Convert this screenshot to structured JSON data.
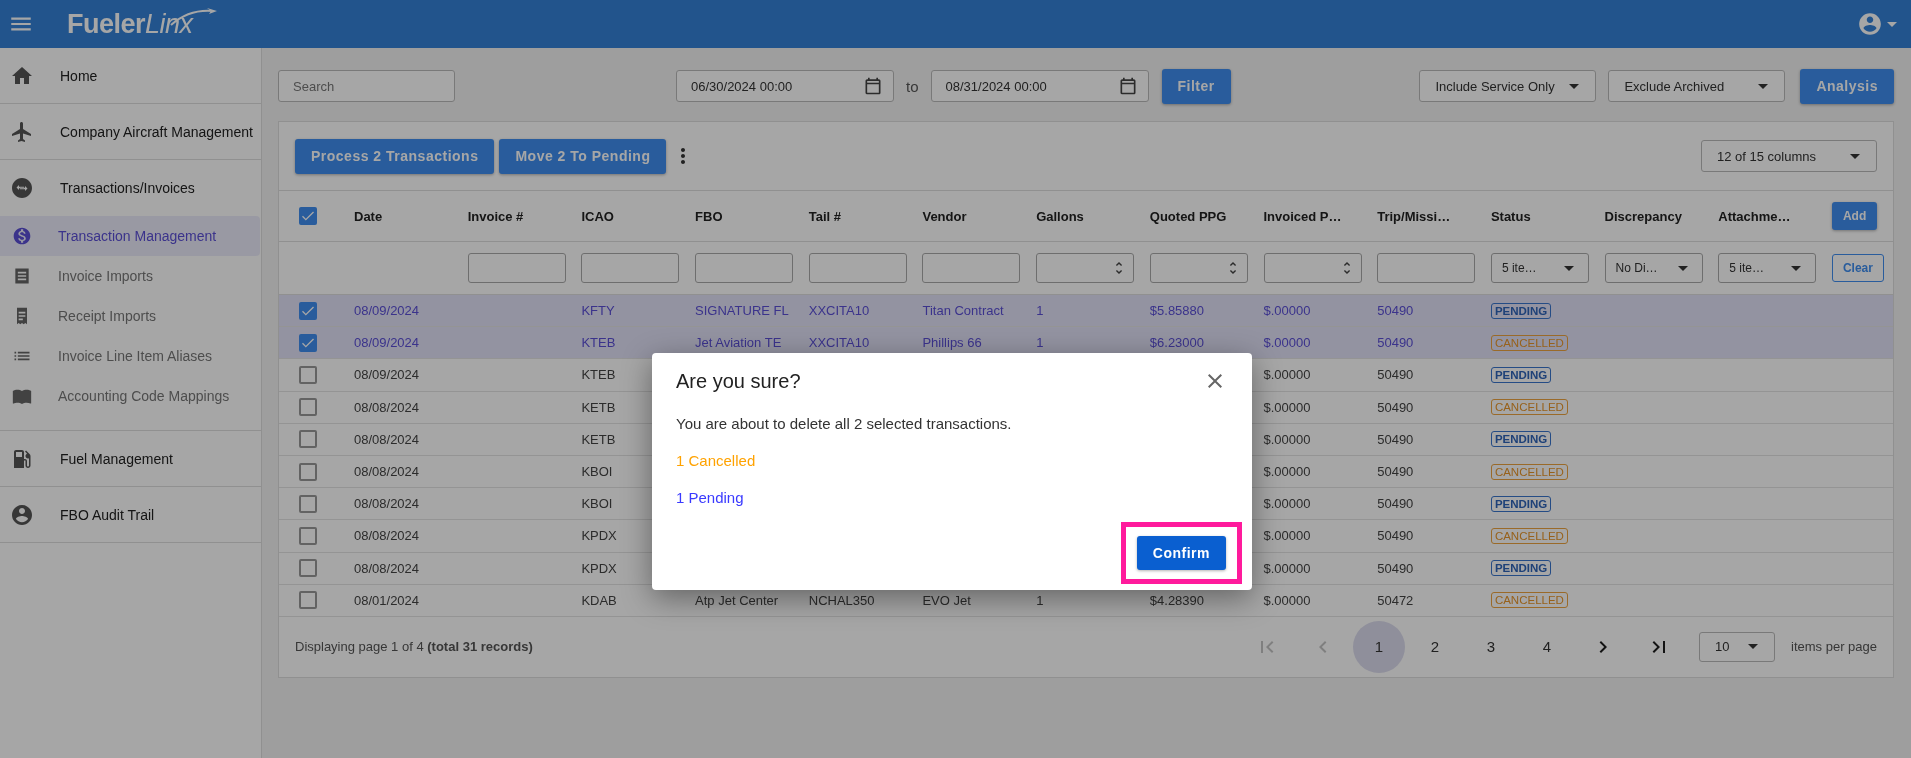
{
  "top_bar": {
    "logo": [
      "Fueler",
      "Linx"
    ]
  },
  "sidebar": {
    "items": [
      {
        "label": "Home",
        "selected": false
      },
      {
        "label": "Company Aircraft Management",
        "selected": false
      },
      {
        "label": "Transactions/Invoices",
        "selected": false,
        "expanded": true,
        "children": [
          {
            "label": "Transaction Management",
            "selected": true
          },
          {
            "label": "Invoice Imports",
            "selected": false
          },
          {
            "label": "Receipt Imports",
            "selected": false
          },
          {
            "label": "Invoice Line Item Aliases",
            "selected": false
          },
          {
            "label": "Accounting Code Mappings",
            "selected": false
          }
        ]
      },
      {
        "label": "Fuel Management",
        "selected": false
      },
      {
        "label": "FBO Audit Trail",
        "selected": false
      }
    ]
  },
  "toolbar": {
    "search": {
      "placeholder": "Search"
    },
    "date_from": "06/30/2024 00:00",
    "to_label": "to",
    "date_to": "08/31/2024 00:00",
    "filter_button": "Filter",
    "dropdowns": [
      "Include Service Only",
      "Exclude Archived"
    ],
    "analysis_button": "Analysis"
  },
  "table_toolbar": {
    "buttons": [
      "Process 2 Transactions",
      "Move 2 To Pending"
    ],
    "columns_dropdown": "12 of 15 columns"
  },
  "table": {
    "select_all_checked": true,
    "add_button": "Add",
    "clear_button": "Clear",
    "columns": [
      "Date",
      "Invoice #",
      "ICAO",
      "FBO",
      "Tail #",
      "Vendor",
      "Gallons",
      "Quoted PPG",
      "Invoiced P…",
      "Trip/Missi…",
      "Status",
      "Discrepancy",
      "Attachme…"
    ],
    "filters": [
      {
        "kind": "none"
      },
      {
        "kind": "text"
      },
      {
        "kind": "text"
      },
      {
        "kind": "text"
      },
      {
        "kind": "text"
      },
      {
        "kind": "text"
      },
      {
        "kind": "number"
      },
      {
        "kind": "number"
      },
      {
        "kind": "number"
      },
      {
        "kind": "text"
      },
      {
        "kind": "select",
        "value": "5 ite…"
      },
      {
        "kind": "select",
        "value": "No Di…"
      },
      {
        "kind": "select",
        "value": "5 ite…"
      }
    ],
    "rows": [
      {
        "selected": true,
        "date": "08/09/2024",
        "icao": "KFTY",
        "fbo": "SIGNATURE FL",
        "tail": "XXCITA10",
        "vendor": "Titan Contract",
        "gallons": "1",
        "quoted": "$5.85880",
        "invoiced": "$.00000",
        "trip": "50490",
        "status": {
          "label": "PENDING",
          "kind": "pending"
        }
      },
      {
        "selected": true,
        "date": "08/09/2024",
        "icao": "KTEB",
        "fbo": "Jet Aviation TE",
        "tail": "XXCITA10",
        "vendor": "Phillips 66",
        "gallons": "1",
        "quoted": "$6.23000",
        "invoiced": "$.00000",
        "trip": "50490",
        "status": {
          "label": "CANCELLED",
          "kind": "cancelled"
        }
      },
      {
        "selected": false,
        "date": "08/09/2024",
        "icao": "KTEB",
        "invoiced": "$.00000",
        "trip": "50490",
        "status": {
          "label": "PENDING",
          "kind": "pending"
        }
      },
      {
        "selected": false,
        "date": "08/08/2024",
        "icao": "KETB",
        "invoiced": "$.00000",
        "trip": "50490",
        "status": {
          "label": "CANCELLED",
          "kind": "cancelled"
        }
      },
      {
        "selected": false,
        "date": "08/08/2024",
        "icao": "KETB",
        "invoiced": "$.00000",
        "trip": "50490",
        "status": {
          "label": "PENDING",
          "kind": "pending"
        }
      },
      {
        "selected": false,
        "date": "08/08/2024",
        "icao": "KBOI",
        "invoiced": "$.00000",
        "trip": "50490",
        "status": {
          "label": "CANCELLED",
          "kind": "cancelled"
        }
      },
      {
        "selected": false,
        "date": "08/08/2024",
        "icao": "KBOI",
        "invoiced": "$.00000",
        "trip": "50490",
        "status": {
          "label": "PENDING",
          "kind": "pending"
        }
      },
      {
        "selected": false,
        "date": "08/08/2024",
        "icao": "KPDX",
        "invoiced": "$.00000",
        "trip": "50490",
        "status": {
          "label": "CANCELLED",
          "kind": "cancelled"
        }
      },
      {
        "selected": false,
        "date": "08/08/2024",
        "icao": "KPDX",
        "invoiced": "$.00000",
        "trip": "50490",
        "status": {
          "label": "PENDING",
          "kind": "pending"
        }
      },
      {
        "selected": false,
        "date": "08/01/2024",
        "icao": "KDAB",
        "fbo": "Atp Jet Center",
        "tail": "NCHAL350",
        "vendor": "EVO Jet",
        "gallons": "1",
        "quoted": "$4.28390",
        "invoiced": "$.00000",
        "trip": "50472",
        "status": {
          "label": "CANCELLED",
          "kind": "cancelled"
        }
      }
    ]
  },
  "pagination": {
    "summary": "Displaying page 1 of 4 **(total 31 records)**",
    "nav": [
      {
        "kind": "first",
        "disabled": true
      },
      {
        "kind": "previous",
        "disabled": true
      },
      {
        "kind": "next",
        "disabled": false
      },
      {
        "kind": "last",
        "disabled": false
      }
    ],
    "pages": [
      {
        "label": "1",
        "selected": true
      },
      {
        "label": "2",
        "selected": false
      },
      {
        "label": "3",
        "selected": false
      },
      {
        "label": "4",
        "selected": false
      }
    ],
    "page_size": "10",
    "page_size_label": "items per page"
  },
  "dialog": {
    "title": "Are you sure?",
    "message": "You are about to delete all 2 selected transactions.",
    "lines": [
      {
        "text": "1 Cancelled",
        "kind": "cancelled"
      },
      {
        "text": "1 Pending",
        "kind": "pending"
      }
    ],
    "confirm_button": {
      "label": "Confirm",
      "highlighted": true
    }
  }
}
